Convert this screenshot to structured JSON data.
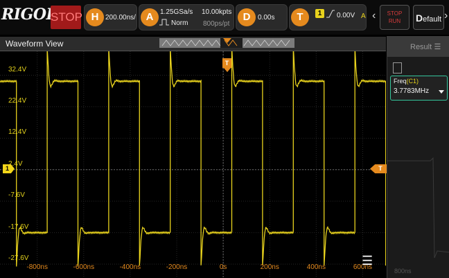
{
  "brand": "RIGOL",
  "run_state": "STOP",
  "horizontal": {
    "key": "H",
    "timebase": "200.00ns/"
  },
  "acquire": {
    "key": "A",
    "sample_rate": "1.25GSa/s",
    "memory": "10.00kpts",
    "mode": "Norm",
    "points": "800ps/pt"
  },
  "delay": {
    "key": "D",
    "value": "0.00s"
  },
  "trigger": {
    "key": "T",
    "source": "1",
    "level": "0.00V",
    "coupling": "A"
  },
  "buttons": {
    "stop_run_line1": "STOP",
    "stop_run_line2": "RUN",
    "default_first": "D",
    "default_rest": "efault"
  },
  "waveform_view": {
    "title": "Waveform View"
  },
  "y_labels": [
    "32.4V",
    "22.4V",
    "12.4V",
    "2.4V",
    "-7.6V",
    "-17.6V",
    "-27.6V"
  ],
  "x_labels": [
    "-800ns",
    "-600ns",
    "-400ns",
    "-200ns",
    "0s",
    "200ns",
    "400ns",
    "600ns"
  ],
  "markers": {
    "channel": "1",
    "trigger": "T"
  },
  "result_panel": {
    "title": "Result",
    "freq_label": "Freq",
    "freq_channel": "(C1)",
    "freq_value": "3.7783MHz",
    "bg_tick": "800ns"
  },
  "colors": {
    "trace": "#e8d21d",
    "accent": "#e58a1e",
    "result_border": "#35c69d",
    "stop_bg": "#a11a1a"
  },
  "chart_data": {
    "type": "line",
    "xlabel": "",
    "ylabel": "",
    "xlim": [
      -960,
      700
    ],
    "ylim": [
      -32,
      40
    ],
    "x_unit": "ns",
    "y_unit": "V",
    "frequency_mhz": 3.7783,
    "high_v": 30.5,
    "low_v": -17.6,
    "first_rising_edge_ns": -757,
    "grid": true
  }
}
